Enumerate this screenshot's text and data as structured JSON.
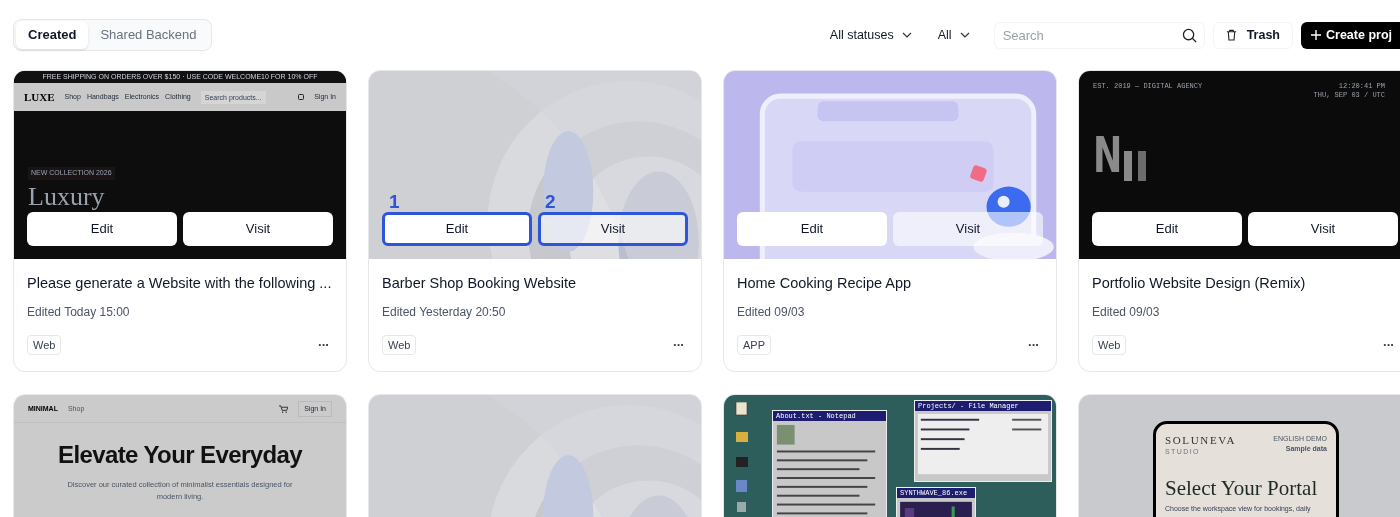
{
  "tabs": [
    {
      "label": "Created",
      "selected": true
    },
    {
      "label": "Shared Backend",
      "selected": false
    }
  ],
  "filters": [
    {
      "label": "All statuses"
    },
    {
      "label": "All"
    }
  ],
  "search": {
    "placeholder": "Search"
  },
  "trash_button": "Trash",
  "create_button": "Create proj",
  "projects": [
    {
      "preview": {
        "kind": "luxe-store",
        "banner": "FREE SHIPPING ON ORDERS OVER $150 · USE CODE WELCOME10 FOR 10% OFF",
        "logo": "LUXE",
        "nav": [
          "Shop",
          "Handbags",
          "Electronics",
          "Clothing"
        ],
        "search": "Search products...",
        "sign_in": "Sign In",
        "eyebrow": "NEW COLLECTION 2026",
        "headline": "Luxury"
      },
      "actions": [
        {
          "label": "Edit",
          "highlighted": false,
          "translucent": false
        },
        {
          "label": "Visit",
          "highlighted": false,
          "translucent": false
        }
      ],
      "title": "Please generate a Website with the following ...",
      "edited": "Edited Today 15:00",
      "tag": "Web",
      "more": "···"
    },
    {
      "preview": {
        "kind": "picture"
      },
      "actions": [
        {
          "label": "Edit",
          "highlighted": true,
          "translucent": false,
          "marker": "1"
        },
        {
          "label": "Visit",
          "highlighted": true,
          "translucent": true,
          "marker": "2"
        }
      ],
      "title": "Barber Shop Booking Website",
      "edited": "Edited Yesterday 20:50",
      "tag": "Web",
      "more": "···"
    },
    {
      "preview": {
        "kind": "picture"
      },
      "actions": [
        {
          "label": "Edit",
          "highlighted": false,
          "translucent": false
        },
        {
          "label": "Visit",
          "highlighted": false,
          "translucent": true
        }
      ],
      "title": "Home Cooking Recipe App",
      "edited": "Edited 09/03",
      "tag": "APP",
      "more": "···"
    },
    {
      "preview": {
        "kind": "agency",
        "eyebrow": "EST. 2019 — DIGITAL AGENCY",
        "clock": "12:20:41 PM",
        "date": "THU, SEP 03 / UTC",
        "headline": "N"
      },
      "actions": [
        {
          "label": "Edit",
          "highlighted": false,
          "translucent": false
        },
        {
          "label": "Visit",
          "highlighted": false,
          "translucent": false
        }
      ],
      "title": "Portfolio Website Design (Remix)",
      "edited": "Edited 09/03",
      "tag": "Web",
      "more": "···"
    },
    {
      "preview": {
        "kind": "minimal-store",
        "logo": "MINIMAL",
        "nav": [
          "Shop"
        ],
        "sign_in": "Sign In",
        "headline": "Elevate Your Everyday",
        "text": "Discover our curated collection of minimalist essentials designed for modern living."
      }
    },
    {
      "preview": {
        "kind": "picture"
      }
    },
    {
      "preview": {
        "kind": "retro-desktop",
        "windows": [
          "About.txt - Notepad",
          "Projects/ - File Manager",
          "SYNTHWAVE_86.exe"
        ]
      }
    },
    {
      "preview": {
        "kind": "portal",
        "logo": "SOLUNEVA",
        "sublogo": "STUDIO",
        "badge": "ENGLISH DEMO",
        "badge_sub": "Sample data",
        "headline": "Select Your Portal",
        "text": "Choose the workspace view for bookings, daily"
      }
    }
  ]
}
